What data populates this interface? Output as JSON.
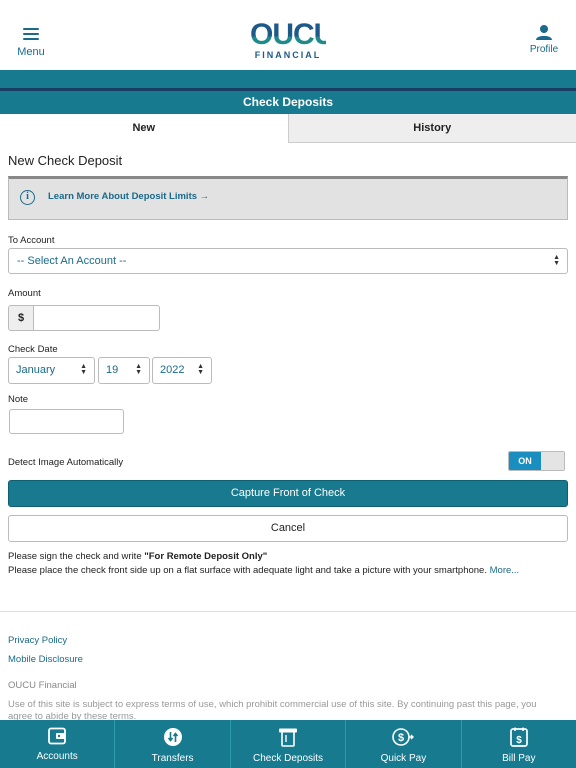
{
  "header": {
    "menu_label": "Menu",
    "logo_main": "OUCU",
    "logo_sub": "FINANCIAL",
    "profile_label": "Profile"
  },
  "page_title": "Check Deposits",
  "tabs": [
    {
      "label": "New",
      "active": true
    },
    {
      "label": "History",
      "active": false
    }
  ],
  "form": {
    "section_title": "New Check Deposit",
    "info_link": "Learn More About Deposit Limits →",
    "to_account_label": "To Account",
    "to_account_value": "-- Select An Account --",
    "amount_label": "Amount",
    "currency_symbol": "$",
    "amount_value": "",
    "check_date_label": "Check Date",
    "month": "January",
    "day": "19",
    "year": "2022",
    "note_label": "Note",
    "note_value": "",
    "detect_label": "Detect Image Automatically",
    "toggle_state": "ON",
    "capture_button": "Capture Front of Check",
    "cancel_button": "Cancel"
  },
  "instructions": {
    "line1_prefix": "Please sign the check and write ",
    "line1_bold": "\"For Remote Deposit Only\"",
    "line2": "Please place the check front side up on a flat surface with adequate light and take a picture with your smartphone. ",
    "more_link": "More..."
  },
  "footer": {
    "privacy_policy": "Privacy Policy",
    "mobile_disclosure": "Mobile Disclosure",
    "org_name": "OUCU Financial",
    "terms": "Use of this site is subject to express terms of use, which prohibit commercial use of this site. By continuing past this page, you agree to abide by these terms."
  },
  "bottom_nav": [
    {
      "label": "Accounts",
      "icon": "wallet-icon"
    },
    {
      "label": "Transfers",
      "icon": "transfer-icon"
    },
    {
      "label": "Check Deposits",
      "icon": "check-deposit-icon"
    },
    {
      "label": "Quick Pay",
      "icon": "quick-pay-icon"
    },
    {
      "label": "Bill Pay",
      "icon": "bill-pay-icon"
    }
  ],
  "colors": {
    "primary_teal": "#177a8e",
    "navy": "#1a3d66",
    "link_blue": "#1a6a8a",
    "toggle_on": "#1a8fbf"
  }
}
